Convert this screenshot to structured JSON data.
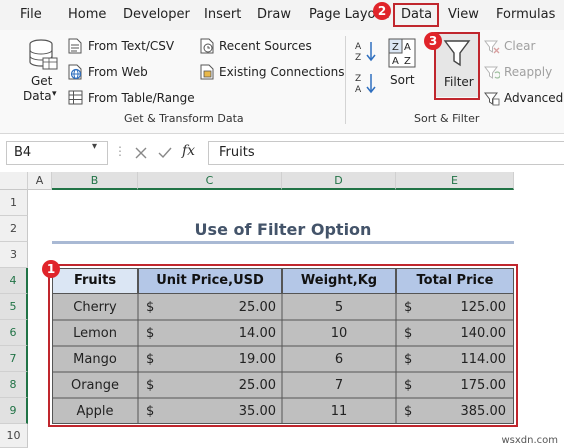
{
  "tabs": [
    "File",
    "Home",
    "Developer",
    "Insert",
    "Draw",
    "Page Layout",
    "Data",
    "View",
    "Formulas"
  ],
  "ribbon": {
    "get_data": {
      "line1": "Get",
      "line2": "Data"
    },
    "get_transform": {
      "from_text_csv": "From Text/CSV",
      "from_web": "From Web",
      "from_table_range": "From Table/Range",
      "recent_sources": "Recent Sources",
      "existing_connections": "Existing Connections",
      "group_label": "Get & Transform Data"
    },
    "sort_filter": {
      "sort": "Sort",
      "filter": "Filter",
      "clear": "Clear",
      "reapply": "Reapply",
      "advanced": "Advanced",
      "group_label": "Sort & Filter"
    }
  },
  "formula_bar": {
    "name_box": "B4",
    "fx": "fx",
    "formula": "Fruits"
  },
  "columns": [
    "A",
    "B",
    "C",
    "D",
    "E"
  ],
  "rows": [
    "1",
    "2",
    "3",
    "4",
    "5",
    "6",
    "7",
    "8",
    "9",
    "10"
  ],
  "sheet": {
    "title": "Use of Filter Option",
    "headers": [
      "Fruits",
      "Unit Price,USD",
      "Weight,Kg",
      "Total Price"
    ],
    "currency": "$",
    "data": [
      [
        "Cherry",
        "25.00",
        "5",
        "125.00"
      ],
      [
        "Lemon",
        "14.00",
        "10",
        "140.00"
      ],
      [
        "Mango",
        "19.00",
        "6",
        "114.00"
      ],
      [
        "Orange",
        "25.00",
        "7",
        "175.00"
      ],
      [
        "Apple",
        "35.00",
        "11",
        "385.00"
      ]
    ]
  },
  "callouts": [
    "1",
    "2",
    "3"
  ],
  "colors": {
    "accent_red": "#c0262d",
    "header_blue": "#b4c7e7",
    "row_gray": "#bfbfbf",
    "title_color": "#44546a"
  },
  "watermark": "wsxdn.com"
}
